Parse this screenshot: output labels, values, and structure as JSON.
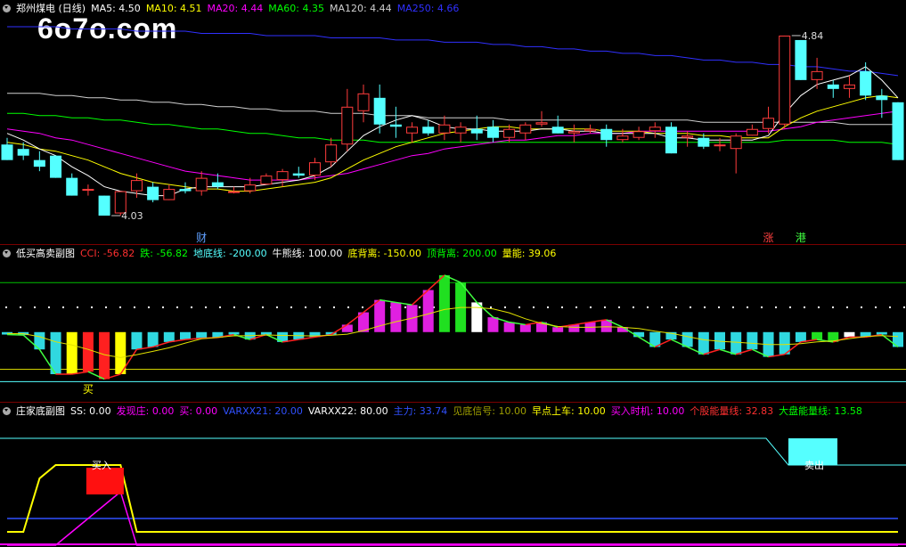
{
  "watermark": "6o7o.com",
  "main": {
    "title": "郑州煤电 (日线)",
    "ma": [
      {
        "label": "MA5: 4.50",
        "color": "#ffffff"
      },
      {
        "label": "MA10: 4.51",
        "color": "#ffff00"
      },
      {
        "label": "MA20: 4.44",
        "color": "#ff00ff"
      },
      {
        "label": "MA60: 4.35",
        "color": "#00ff00"
      },
      {
        "label": "MA120: 4.44",
        "color": "#d0d0d0"
      },
      {
        "label": "MA250: 4.66",
        "color": "#3030ff"
      }
    ],
    "high_label": "4.84",
    "low_label": "4.03",
    "markers": [
      "财",
      "涨",
      "港"
    ]
  },
  "sub1": {
    "title": "低买高卖副图",
    "items": [
      {
        "label": "CCI: -56.82",
        "color": "#ff3030"
      },
      {
        "label": "跌: -56.82",
        "color": "#00ff00"
      },
      {
        "label": "地底线: -200.00",
        "color": "#55ffff"
      },
      {
        "label": "牛熊线: 100.00",
        "color": "#ffffff"
      },
      {
        "label": "底背离: -150.00",
        "color": "#ffff00"
      },
      {
        "label": "顶背离: 200.00",
        "color": "#00ff00"
      },
      {
        "label": "量能: 39.06",
        "color": "#ffff00"
      }
    ],
    "buy_label": "买"
  },
  "sub2": {
    "title": "庄家底副图",
    "items": [
      {
        "label": "SS: 0.00",
        "color": "#ffffff"
      },
      {
        "label": "发现庄: 0.00",
        "color": "#ff00ff"
      },
      {
        "label": "买: 0.00",
        "color": "#ff00ff"
      },
      {
        "label": "VARXX21: 20.00",
        "color": "#3050ff"
      },
      {
        "label": "VARXX22: 80.00",
        "color": "#ffffff"
      },
      {
        "label": "主力: 33.74",
        "color": "#3050ff"
      },
      {
        "label": "见底信号: 10.00",
        "color": "#a0a000"
      },
      {
        "label": "早点上车: 10.00",
        "color": "#ffff00"
      },
      {
        "label": "买入时机: 10.00",
        "color": "#ff00ff"
      },
      {
        "label": "个股能量线: 32.83",
        "color": "#ff3030"
      },
      {
        "label": "大盘能量线: 13.58",
        "color": "#00ff00"
      }
    ],
    "buy_in_label": "买入",
    "sell_label": "卖出"
  },
  "chart_data": {
    "type": "candlestick",
    "title": "郑州煤电 (日线)",
    "xlabel": "",
    "ylabel": "",
    "ylim": [
      3.95,
      4.92
    ],
    "up_color": "#ff3c3c",
    "down_color": "#54ffff",
    "candles": [
      {
        "o": 4.35,
        "h": 4.38,
        "l": 4.28,
        "c": 4.28
      },
      {
        "o": 4.33,
        "h": 4.36,
        "l": 4.28,
        "c": 4.3
      },
      {
        "o": 4.28,
        "h": 4.32,
        "l": 4.23,
        "c": 4.25
      },
      {
        "o": 4.3,
        "h": 4.3,
        "l": 4.2,
        "c": 4.2
      },
      {
        "o": 4.2,
        "h": 4.22,
        "l": 4.12,
        "c": 4.12
      },
      {
        "o": 4.15,
        "h": 4.17,
        "l": 4.12,
        "c": 4.15
      },
      {
        "o": 4.12,
        "h": 4.12,
        "l": 4.03,
        "c": 4.03
      },
      {
        "o": 4.04,
        "h": 4.14,
        "l": 4.03,
        "c": 4.14
      },
      {
        "o": 4.14,
        "h": 4.22,
        "l": 4.11,
        "c": 4.19
      },
      {
        "o": 4.16,
        "h": 4.18,
        "l": 4.09,
        "c": 4.1
      },
      {
        "o": 4.1,
        "h": 4.17,
        "l": 4.1,
        "c": 4.15
      },
      {
        "o": 4.15,
        "h": 4.18,
        "l": 4.13,
        "c": 4.14
      },
      {
        "o": 4.14,
        "h": 4.23,
        "l": 4.12,
        "c": 4.2
      },
      {
        "o": 4.18,
        "h": 4.22,
        "l": 4.15,
        "c": 4.16
      },
      {
        "o": 4.14,
        "h": 4.16,
        "l": 4.13,
        "c": 4.14
      },
      {
        "o": 4.14,
        "h": 4.2,
        "l": 4.13,
        "c": 4.17
      },
      {
        "o": 4.17,
        "h": 4.22,
        "l": 4.17,
        "c": 4.21
      },
      {
        "o": 4.19,
        "h": 4.24,
        "l": 4.16,
        "c": 4.23
      },
      {
        "o": 4.22,
        "h": 4.25,
        "l": 4.2,
        "c": 4.21
      },
      {
        "o": 4.21,
        "h": 4.29,
        "l": 4.19,
        "c": 4.27
      },
      {
        "o": 4.27,
        "h": 4.38,
        "l": 4.25,
        "c": 4.35
      },
      {
        "o": 4.35,
        "h": 4.6,
        "l": 4.32,
        "c": 4.52
      },
      {
        "o": 4.5,
        "h": 4.62,
        "l": 4.45,
        "c": 4.58
      },
      {
        "o": 4.56,
        "h": 4.62,
        "l": 4.4,
        "c": 4.44
      },
      {
        "o": 4.44,
        "h": 4.52,
        "l": 4.38,
        "c": 4.43
      },
      {
        "o": 4.4,
        "h": 4.45,
        "l": 4.36,
        "c": 4.43
      },
      {
        "o": 4.43,
        "h": 4.46,
        "l": 4.39,
        "c": 4.4
      },
      {
        "o": 4.4,
        "h": 4.48,
        "l": 4.37,
        "c": 4.44
      },
      {
        "o": 4.4,
        "h": 4.45,
        "l": 4.36,
        "c": 4.43
      },
      {
        "o": 4.42,
        "h": 4.48,
        "l": 4.37,
        "c": 4.4
      },
      {
        "o": 4.43,
        "h": 4.46,
        "l": 4.36,
        "c": 4.38
      },
      {
        "o": 4.38,
        "h": 4.44,
        "l": 4.36,
        "c": 4.42
      },
      {
        "o": 4.4,
        "h": 4.45,
        "l": 4.37,
        "c": 4.44
      },
      {
        "o": 4.44,
        "h": 4.5,
        "l": 4.43,
        "c": 4.45
      },
      {
        "o": 4.43,
        "h": 4.48,
        "l": 4.4,
        "c": 4.4
      },
      {
        "o": 4.4,
        "h": 4.44,
        "l": 4.36,
        "c": 4.41
      },
      {
        "o": 4.41,
        "h": 4.44,
        "l": 4.4,
        "c": 4.42
      },
      {
        "o": 4.42,
        "h": 4.44,
        "l": 4.34,
        "c": 4.37
      },
      {
        "o": 4.37,
        "h": 4.42,
        "l": 4.36,
        "c": 4.39
      },
      {
        "o": 4.38,
        "h": 4.43,
        "l": 4.37,
        "c": 4.41
      },
      {
        "o": 4.41,
        "h": 4.45,
        "l": 4.38,
        "c": 4.43
      },
      {
        "o": 4.43,
        "h": 4.45,
        "l": 4.31,
        "c": 4.31
      },
      {
        "o": 4.38,
        "h": 4.41,
        "l": 4.34,
        "c": 4.39
      },
      {
        "o": 4.38,
        "h": 4.4,
        "l": 4.33,
        "c": 4.34
      },
      {
        "o": 4.35,
        "h": 4.38,
        "l": 4.32,
        "c": 4.35
      },
      {
        "o": 4.33,
        "h": 4.4,
        "l": 4.22,
        "c": 4.39
      },
      {
        "o": 4.39,
        "h": 4.44,
        "l": 4.39,
        "c": 4.42
      },
      {
        "o": 4.42,
        "h": 4.52,
        "l": 4.4,
        "c": 4.47
      },
      {
        "o": 4.44,
        "h": 4.84,
        "l": 4.42,
        "c": 4.84
      },
      {
        "o": 4.82,
        "h": 4.82,
        "l": 4.64,
        "c": 4.64
      },
      {
        "o": 4.64,
        "h": 4.74,
        "l": 4.6,
        "c": 4.68
      },
      {
        "o": 4.62,
        "h": 4.64,
        "l": 4.56,
        "c": 4.6
      },
      {
        "o": 4.6,
        "h": 4.66,
        "l": 4.56,
        "c": 4.62
      },
      {
        "o": 4.68,
        "h": 4.72,
        "l": 4.55,
        "c": 4.57
      },
      {
        "o": 4.57,
        "h": 4.6,
        "l": 4.47,
        "c": 4.55
      },
      {
        "o": 4.54,
        "h": 4.54,
        "l": 4.28,
        "c": 4.28
      }
    ],
    "moving_averages": [
      {
        "name": "MA5",
        "color": "#ffffff",
        "values": [
          4.4,
          4.37,
          4.33,
          4.3,
          4.25,
          4.21,
          4.16,
          4.14,
          4.13,
          4.12,
          4.12,
          4.15,
          4.16,
          4.16,
          4.16,
          4.16,
          4.17,
          4.18,
          4.19,
          4.21,
          4.25,
          4.32,
          4.39,
          4.43,
          4.46,
          4.48,
          4.46,
          4.43,
          4.42,
          4.42,
          4.41,
          4.41,
          4.41,
          4.42,
          4.42,
          4.41,
          4.41,
          4.4,
          4.4,
          4.4,
          4.4,
          4.38,
          4.38,
          4.37,
          4.37,
          4.37,
          4.37,
          4.39,
          4.49,
          4.57,
          4.62,
          4.64,
          4.66,
          4.7,
          4.64,
          4.56
        ]
      },
      {
        "name": "MA10",
        "color": "#ffff00",
        "values": [
          4.36,
          4.35,
          4.33,
          4.32,
          4.3,
          4.28,
          4.25,
          4.22,
          4.2,
          4.18,
          4.17,
          4.16,
          4.15,
          4.15,
          4.14,
          4.14,
          4.15,
          4.16,
          4.17,
          4.18,
          4.2,
          4.24,
          4.28,
          4.31,
          4.34,
          4.36,
          4.38,
          4.4,
          4.41,
          4.42,
          4.43,
          4.43,
          4.42,
          4.42,
          4.42,
          4.42,
          4.42,
          4.41,
          4.41,
          4.41,
          4.4,
          4.4,
          4.4,
          4.39,
          4.39,
          4.38,
          4.38,
          4.38,
          4.43,
          4.47,
          4.5,
          4.52,
          4.54,
          4.56,
          4.57,
          4.56
        ]
      },
      {
        "name": "MA20",
        "color": "#ff00ff",
        "values": [
          4.42,
          4.41,
          4.4,
          4.38,
          4.37,
          4.35,
          4.33,
          4.31,
          4.29,
          4.27,
          4.25,
          4.23,
          4.22,
          4.21,
          4.2,
          4.19,
          4.19,
          4.19,
          4.19,
          4.2,
          4.21,
          4.22,
          4.24,
          4.26,
          4.28,
          4.3,
          4.31,
          4.33,
          4.34,
          4.35,
          4.36,
          4.37,
          4.37,
          4.38,
          4.39,
          4.39,
          4.4,
          4.4,
          4.4,
          4.41,
          4.41,
          4.41,
          4.41,
          4.41,
          4.41,
          4.41,
          4.41,
          4.41,
          4.42,
          4.43,
          4.45,
          4.46,
          4.47,
          4.48,
          4.49,
          4.5
        ]
      },
      {
        "name": "MA60",
        "color": "#00ff00",
        "values": [
          4.49,
          4.49,
          4.48,
          4.48,
          4.47,
          4.47,
          4.46,
          4.46,
          4.45,
          4.44,
          4.44,
          4.43,
          4.42,
          4.42,
          4.41,
          4.4,
          4.4,
          4.39,
          4.38,
          4.38,
          4.37,
          4.37,
          4.37,
          4.36,
          4.36,
          4.36,
          4.36,
          4.36,
          4.36,
          4.36,
          4.36,
          4.36,
          4.36,
          4.36,
          4.36,
          4.36,
          4.36,
          4.36,
          4.36,
          4.36,
          4.36,
          4.36,
          4.36,
          4.36,
          4.36,
          4.36,
          4.36,
          4.36,
          4.37,
          4.37,
          4.37,
          4.37,
          4.36,
          4.36,
          4.36,
          4.35
        ]
      },
      {
        "name": "MA120",
        "color": "#d0d0d0",
        "values": [
          4.58,
          4.58,
          4.58,
          4.57,
          4.57,
          4.56,
          4.56,
          4.55,
          4.55,
          4.54,
          4.54,
          4.53,
          4.53,
          4.52,
          4.52,
          4.51,
          4.51,
          4.5,
          4.5,
          4.5,
          4.49,
          4.49,
          4.49,
          4.48,
          4.48,
          4.48,
          4.47,
          4.47,
          4.47,
          4.47,
          4.47,
          4.46,
          4.46,
          4.46,
          4.46,
          4.46,
          4.46,
          4.46,
          4.46,
          4.46,
          4.46,
          4.46,
          4.46,
          4.45,
          4.45,
          4.45,
          4.45,
          4.45,
          4.45,
          4.45,
          4.45,
          4.45,
          4.44,
          4.44,
          4.44,
          4.44
        ]
      },
      {
        "name": "MA250",
        "color": "#3030ff",
        "values": [
          4.88,
          4.88,
          4.88,
          4.88,
          4.87,
          4.87,
          4.87,
          4.87,
          4.86,
          4.86,
          4.86,
          4.86,
          4.85,
          4.85,
          4.85,
          4.85,
          4.84,
          4.84,
          4.84,
          4.84,
          4.83,
          4.83,
          4.83,
          4.83,
          4.82,
          4.82,
          4.82,
          4.81,
          4.81,
          4.81,
          4.8,
          4.8,
          4.79,
          4.79,
          4.78,
          4.78,
          4.77,
          4.77,
          4.76,
          4.76,
          4.75,
          4.75,
          4.74,
          4.73,
          4.73,
          4.72,
          4.72,
          4.71,
          4.71,
          4.7,
          4.7,
          4.69,
          4.68,
          4.68,
          4.67,
          4.66
        ]
      }
    ],
    "cci": {
      "ylim": [
        -260,
        280
      ],
      "levels": [
        {
          "name": "顶背离",
          "value": 200,
          "color": "#00c000"
        },
        {
          "name": "牛熊线",
          "value": 100,
          "color": "#ffffff"
        },
        {
          "name": "底背离",
          "value": -150,
          "color": "#d0d000"
        },
        {
          "name": "地底线",
          "value": -200,
          "color": "#55ffff"
        }
      ],
      "values": [
        -10,
        -12,
        -70,
        -170,
        -170,
        -160,
        -190,
        -170,
        -70,
        -60,
        -40,
        -30,
        -25,
        -22,
        -10,
        -30,
        -10,
        -40,
        -30,
        -20,
        -10,
        30,
        80,
        130,
        120,
        110,
        170,
        230,
        200,
        120,
        60,
        40,
        30,
        40,
        20,
        30,
        40,
        50,
        20,
        -20,
        -60,
        -30,
        -60,
        -90,
        -70,
        -90,
        -70,
        -100,
        -90,
        -40,
        -30,
        -40,
        -20,
        -20,
        -10,
        -60
      ]
    },
    "zhuangjia": {
      "ylim": [
        0,
        100
      ],
      "series": [
        {
          "name": "VARXX22",
          "color": "#55ffff",
          "values": [
            80,
            80,
            80,
            80,
            80,
            80,
            80,
            80,
            80,
            80,
            80,
            80,
            80,
            80,
            80,
            80,
            80,
            80,
            80,
            80,
            80,
            80,
            80,
            80,
            80,
            80,
            80,
            80,
            80,
            80,
            80,
            80,
            80,
            80,
            80,
            80,
            80,
            80,
            80,
            80,
            80,
            80,
            80,
            80,
            80,
            80,
            80,
            80,
            80,
            80,
            80,
            80,
            80,
            80,
            80,
            80
          ]
        },
        {
          "name": "VARXX21",
          "color": "#3050ff",
          "values": [
            20,
            20,
            20,
            20,
            20,
            20,
            20,
            20,
            20,
            20,
            20,
            20,
            20,
            20,
            20,
            20,
            20,
            20,
            20,
            20,
            20,
            20,
            20,
            20,
            20,
            20,
            20,
            20,
            20,
            20,
            20,
            20,
            20,
            20,
            20,
            20,
            20,
            20,
            20,
            20,
            20,
            20,
            20,
            20,
            20,
            20,
            20,
            20,
            20,
            20,
            20,
            20,
            20,
            20,
            20,
            20
          ]
        },
        {
          "name": "早点上车",
          "color": "#ffff00",
          "values": [
            10,
            10,
            50,
            60,
            60,
            60,
            60,
            60,
            10,
            10,
            10,
            10,
            10,
            10,
            10,
            10,
            10,
            10,
            10,
            10,
            10,
            10,
            10,
            10,
            10,
            10,
            10,
            10,
            10,
            10,
            10,
            10,
            10,
            10,
            10,
            10,
            10,
            10,
            10,
            10,
            10,
            10,
            10,
            10,
            10,
            10,
            10,
            10,
            10,
            10,
            10,
            10,
            10,
            10,
            10,
            10
          ]
        },
        {
          "name": "买入时机",
          "color": "#ff00ff",
          "values": [
            0,
            0,
            0,
            0,
            10,
            20,
            30,
            40,
            0,
            0,
            0,
            0,
            0,
            0,
            0,
            0,
            0,
            0,
            0,
            0,
            0,
            0,
            0,
            0,
            0,
            0,
            0,
            0,
            0,
            0,
            0,
            0,
            0,
            0,
            0,
            0,
            0,
            0,
            0,
            0,
            0,
            0,
            0,
            0,
            0,
            0,
            0,
            0,
            0,
            0,
            0,
            0,
            0,
            0,
            0,
            0
          ]
        }
      ]
    }
  }
}
